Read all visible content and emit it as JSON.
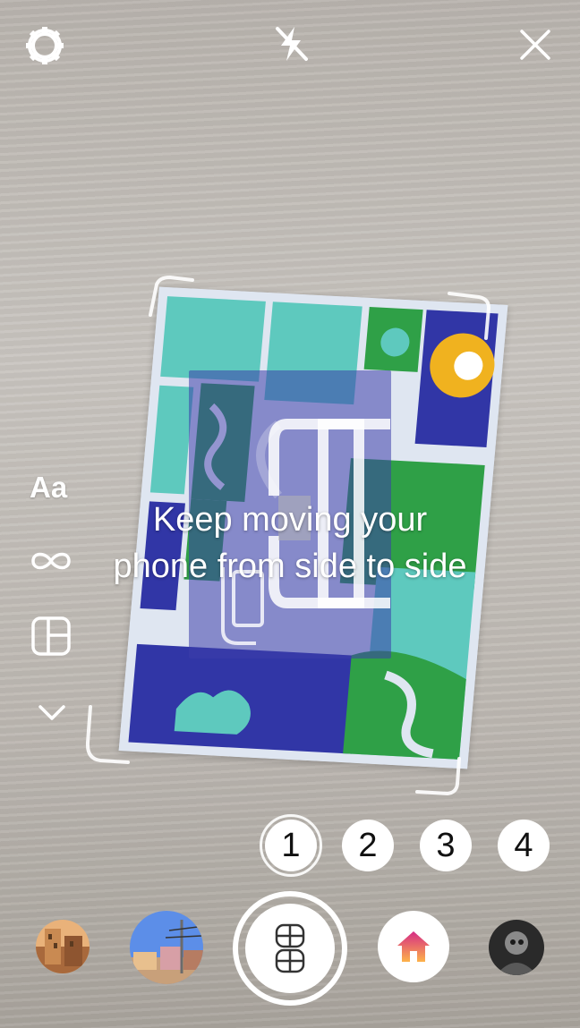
{
  "top_bar": {
    "settings_icon": "gear-icon",
    "flash_icon": "flash-off-icon",
    "close_icon": "close-icon"
  },
  "ar_overlay": {
    "instruction": "Keep moving your phone from side to side"
  },
  "left_tools": {
    "text_tool_label": "Aa",
    "boomerang_icon": "infinity-icon",
    "layout_icon": "layout-grid-icon",
    "more_icon": "chevron-down-icon"
  },
  "count_selector": {
    "options": [
      "1",
      "2",
      "3",
      "4"
    ],
    "selected": "1"
  },
  "bottom_bar": {
    "shutter_icon": "layout-grid-icon",
    "home_icon": "home-icon"
  },
  "colors": {
    "poster_blue": "#3136a6",
    "poster_teal": "#5ec9be",
    "poster_green": "#2fa047",
    "poster_yellow": "#f0b21f",
    "home_gradient_start": "#fdb24a",
    "home_gradient_end": "#d52b86"
  }
}
